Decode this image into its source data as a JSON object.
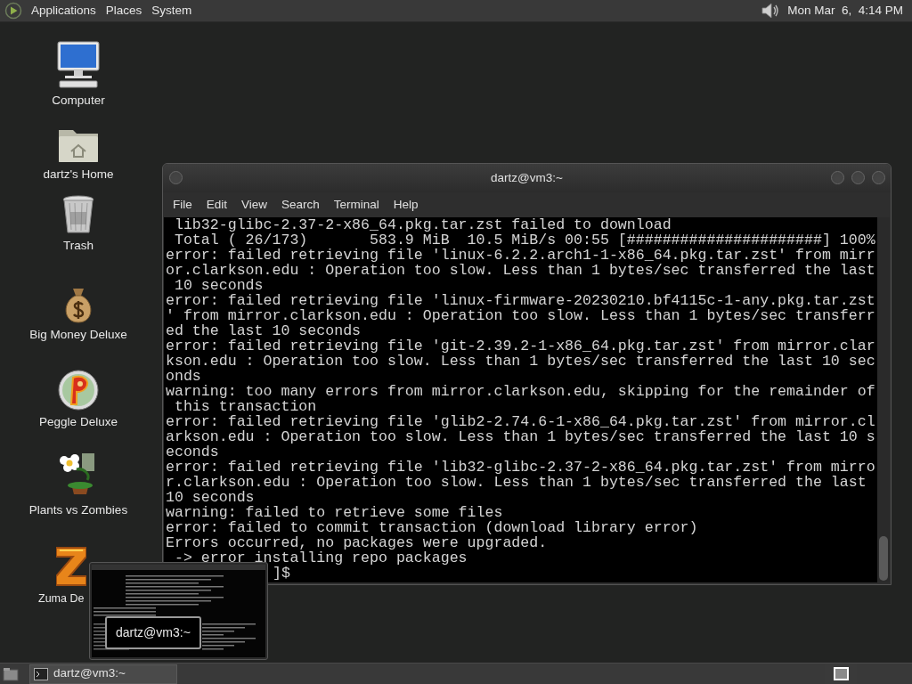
{
  "top_panel": {
    "menus": [
      "Applications",
      "Places",
      "System"
    ],
    "clock": "Mon Mar  6,  4:14 PM"
  },
  "desktop_icons": [
    {
      "label": "Computer",
      "kind": "computer"
    },
    {
      "label": "dartz's Home",
      "kind": "home"
    },
    {
      "label": "Trash",
      "kind": "trash"
    },
    {
      "label": "Big Money Deluxe",
      "kind": "money"
    },
    {
      "label": "Peggle Deluxe",
      "kind": "peggle"
    },
    {
      "label": "Plants vs Zombies",
      "kind": "plants"
    },
    {
      "label": "Zuma De",
      "kind": "zuma"
    }
  ],
  "terminal_window": {
    "title": "dartz@vm3:~",
    "menu": [
      "File",
      "Edit",
      "View",
      "Search",
      "Terminal",
      "Help"
    ],
    "lines": [
      " lib32-glibc-2.37-2-x86_64.pkg.tar.zst failed to download",
      " Total ( 26/173)       583.9 MiB  10.5 MiB/s 00:55 [######################] 100%",
      "error: failed retrieving file 'linux-6.2.2.arch1-1-x86_64.pkg.tar.zst' from mirr",
      "or.clarkson.edu : Operation too slow. Less than 1 bytes/sec transferred the last",
      " 10 seconds",
      "error: failed retrieving file 'linux-firmware-20230210.bf4115c-1-any.pkg.tar.zst",
      "' from mirror.clarkson.edu : Operation too slow. Less than 1 bytes/sec transferr",
      "ed the last 10 seconds",
      "error: failed retrieving file 'git-2.39.2-1-x86_64.pkg.tar.zst' from mirror.clar",
      "kson.edu : Operation too slow. Less than 1 bytes/sec transferred the last 10 sec",
      "onds",
      "warning: too many errors from mirror.clarkson.edu, skipping for the remainder of",
      " this transaction",
      "error: failed retrieving file 'glib2-2.74.6-1-x86_64.pkg.tar.zst' from mirror.cl",
      "arkson.edu : Operation too slow. Less than 1 bytes/sec transferred the last 10 s",
      "econds",
      "error: failed retrieving file 'lib32-glibc-2.37-2-x86_64.pkg.tar.zst' from mirro",
      "r.clarkson.edu : Operation too slow. Less than 1 bytes/sec transferred the last",
      "10 seconds",
      "warning: failed to retrieve some files",
      "error: failed to commit transaction (download library error)",
      "Errors occurred, no packages were upgraded.",
      " -> error installing repo packages"
    ],
    "prompt_tail": "]$"
  },
  "window_preview": {
    "title": "dartz@vm3:~"
  },
  "taskbar": {
    "tasks": [
      {
        "label": "dartz@vm3:~",
        "selected": true
      }
    ]
  }
}
